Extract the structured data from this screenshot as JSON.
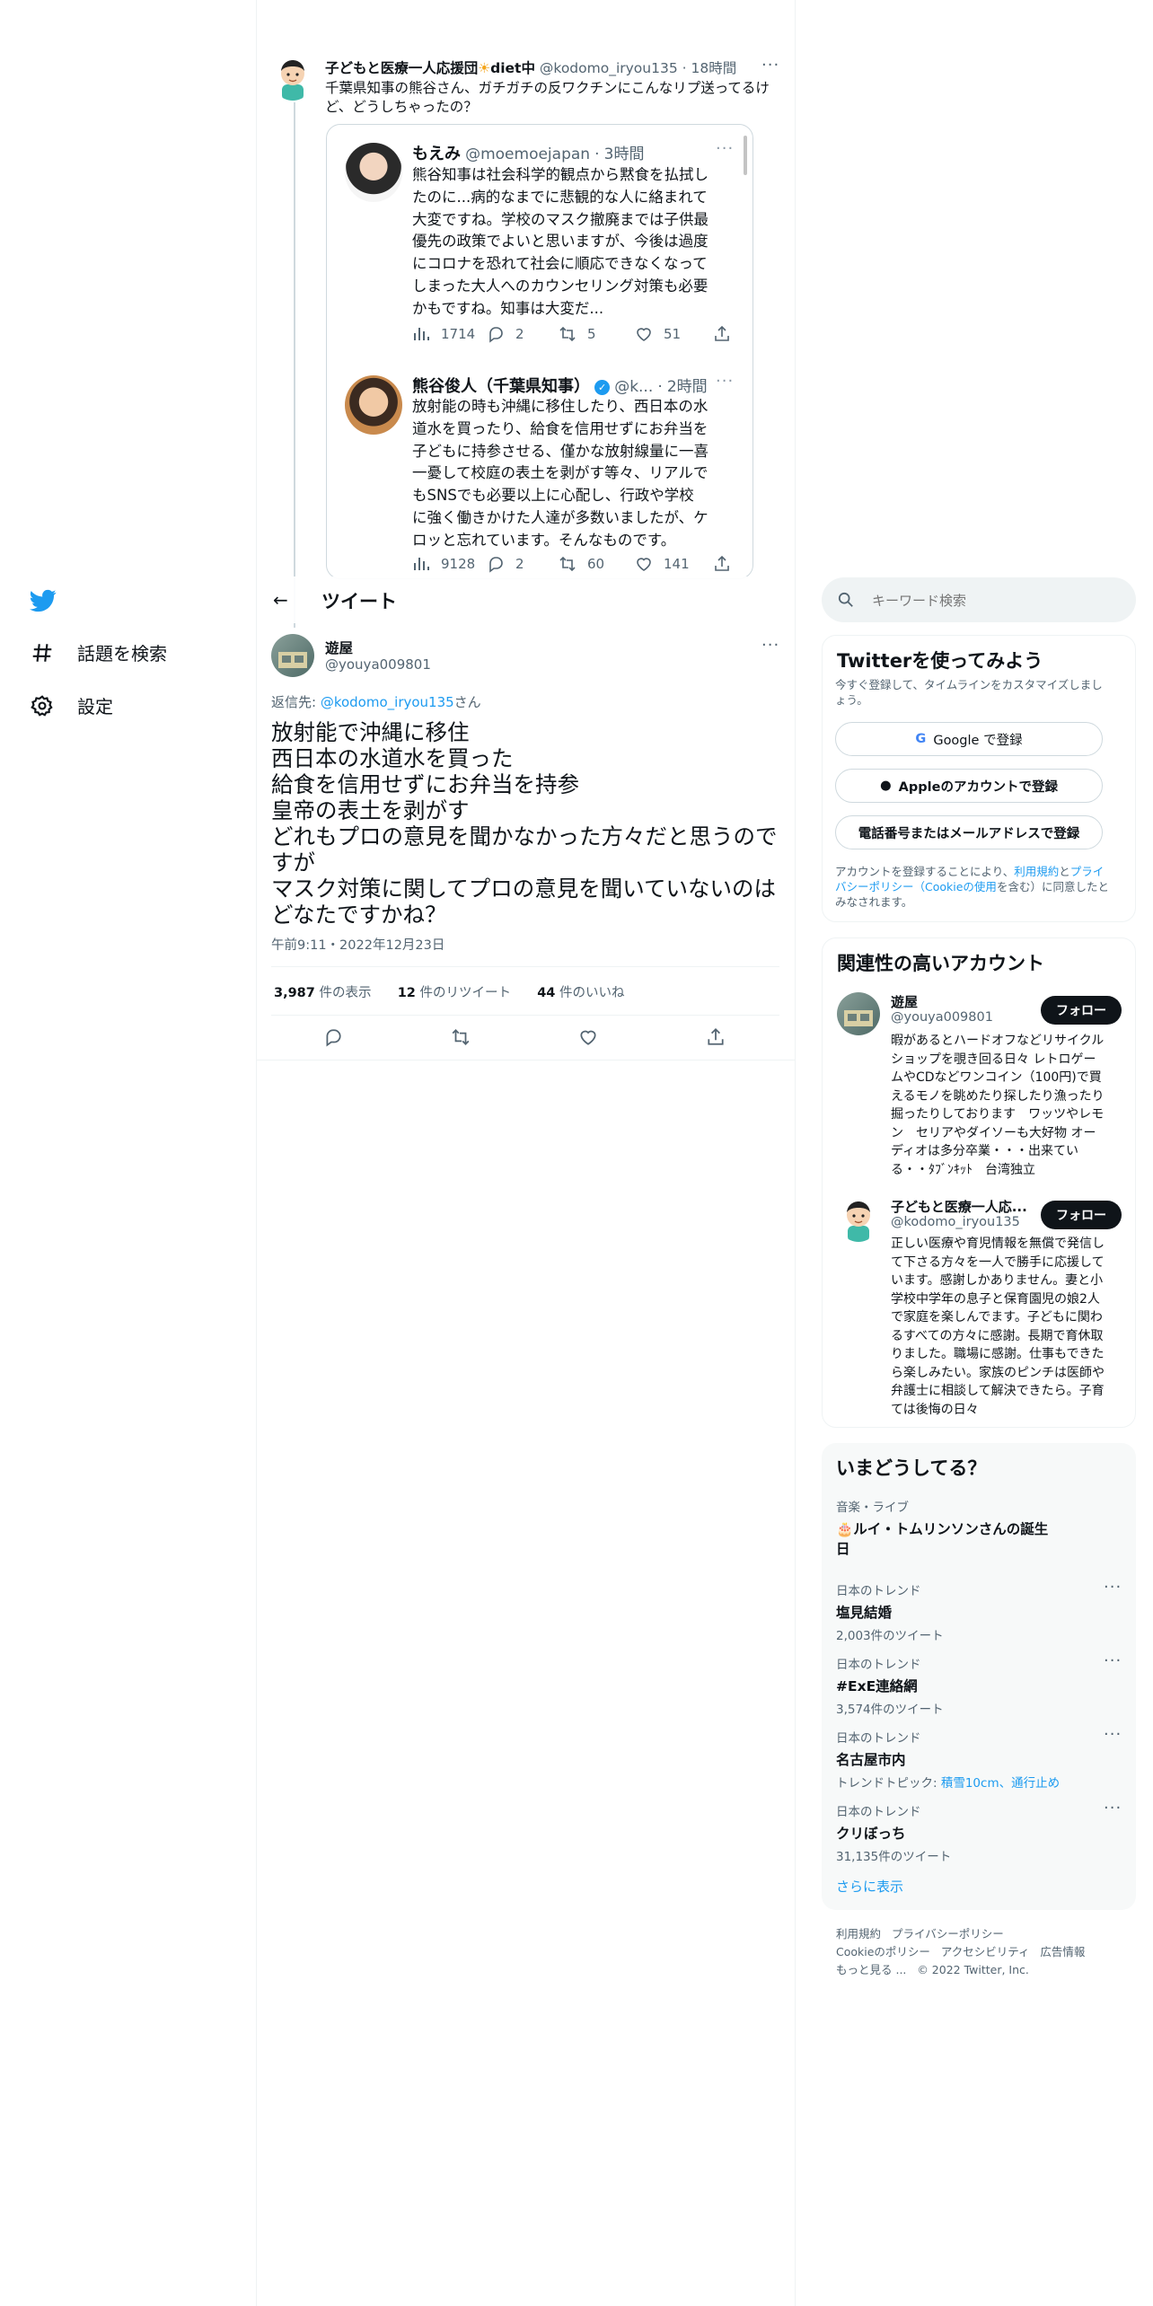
{
  "nav": {
    "items": [
      {
        "label": "話題を検索"
      },
      {
        "label": "設定"
      }
    ]
  },
  "header": {
    "title": "ツイート"
  },
  "parent_tweet": {
    "display_name": "子どもと医療一人応援団",
    "name_suffix": "diet中",
    "handle": "@kodomo_iryou135",
    "time": "18時間",
    "text_line1": "千葉県知事の熊谷さん、ガチガチの反ワクチンにこんなリプ送ってるけ",
    "text_line2": "ど、どうしちゃったの？"
  },
  "quote1": {
    "display_name": "もえみ",
    "handle": "@moemoejapan",
    "time": "3時間",
    "lines": [
      "熊谷知事は社会科学的観点から黙食を払拭し",
      "たのに...病的なまでに悲観的な人に絡まれて",
      "大変ですね。学校のマスク撤廃までは子供最",
      "優先の政策でよいと思いますが、今後は過度",
      "にコロナを恐れて社会に順応できなくなって",
      "しまった大人へのカウンセリング対策も必要",
      "かもですね。知事は大変だ..."
    ],
    "views": "1714",
    "replies": "2",
    "retweets": "5",
    "likes": "51"
  },
  "quote2": {
    "display_name": "熊谷俊人（千葉県知事）",
    "handle": "@k...",
    "time": "2時間",
    "lines": [
      "放射能の時も沖縄に移住したり、西日本の水",
      "道水を買ったり、給食を信用せずにお弁当を",
      "子どもに持参させる、僅かな放射線量に一喜",
      "一憂して校庭の表土を剥がす等々、リアルで",
      "もSNSでも必要以上に心配し、行政や学校",
      "に強く働きかけた人達が多数いましたが、ケ",
      "ロッと忘れています。そんなものです。"
    ],
    "views": "9128",
    "replies": "2",
    "retweets": "60",
    "likes": "141"
  },
  "main_tweet": {
    "display_name": "遊屋",
    "handle": "@youya009801",
    "reply_prefix": "返信先: ",
    "reply_to": "@kodomo_iryou135",
    "reply_suffix": "さん",
    "lines": [
      "放射能で沖縄に移住",
      "西日本の水道水を買った",
      "給食を信用せずにお弁当を持参",
      "皇帝の表土を剥がす",
      "どれもプロの意見を聞かなかった方々だと思うので",
      "すが",
      "マスク対策に関してプロの意見を聞いていないのは",
      "どなたですかね？"
    ],
    "timestamp": "午前9:11・2022年12月23日",
    "views_count": "3,987",
    "views_label": "件の表示",
    "retweets_count": "12",
    "retweets_label": "件のリツイート",
    "likes_count": "44",
    "likes_label": "件のいいね"
  },
  "search": {
    "placeholder": "キーワード検索"
  },
  "signup": {
    "title": "Twitterを使ってみよう",
    "subtitle": "今すぐ登録して、タイムラインをカスタマイズしまし",
    "subtitle2": "ょう。",
    "google": "Google で登録",
    "apple": "Appleのアカウントで登録",
    "phone": "電話番号またはメールアドレスで登録",
    "terms_a": "アカウントを登録することにより、",
    "terms_link1": "利用規約",
    "terms_b": "と",
    "terms_link2": "プライ",
    "terms_link3": "バシーポリシー（Cookieの使用",
    "terms_c": "を含む）に同意したと",
    "terms_d": "みなされます。"
  },
  "relevant": {
    "title": "関連性の高いアカウント",
    "accounts": [
      {
        "name": "遊屋",
        "handle": "@youya009801",
        "follow": "フォロー",
        "bio": [
          "暇があるとハードオフなどリサイクル",
          "ショップを覗き回る日々 レトロゲー",
          "ムやCDなどワンコイン（100円)で買",
          "えるモノを眺めたり探したり漁ったり",
          "掘ったりしております　ワッツやレモ",
          "ン　セリアやダイソーも大好物 オー",
          "ディオは多分卒業・・・出来てい",
          "る・・ﾀﾌﾞﾝｷｯﾄ　台湾独立"
        ]
      },
      {
        "name": "子どもと医療一人応...",
        "handle": "@kodomo_iryou135",
        "follow": "フォロー",
        "bio": [
          "正しい医療や育児情報を無償で発信し",
          "て下さる方々を一人で勝手に応援して",
          "います。感謝しかありません。妻と小",
          "学校中学年の息子と保育園児の娘2人",
          "で家庭を楽しんでます。子どもに関わ",
          "るすべての方々に感謝。長期で育休取",
          "りました。職場に感謝。仕事もできた",
          "ら楽しみたい。家族のピンチは医師や",
          "弁護士に相談して解決できたら。子育",
          "ては後悔の日々"
        ]
      }
    ]
  },
  "trends": {
    "title": "いまどうしてる？",
    "items": [
      {
        "category": "音楽・ライブ",
        "name1": "🎂ルイ・トムリンソンさんの誕生",
        "name2": "日"
      },
      {
        "category": "日本のトレンド",
        "name": "塩見結婚",
        "count": "2,003件のツイート"
      },
      {
        "category": "日本のトレンド",
        "name": "#ExE連絡網",
        "count": "3,574件のツイート"
      },
      {
        "category": "日本のトレンド",
        "name": "名古屋市内",
        "topic_prefix": "トレンドトピック: ",
        "topic": "積雪10cm、通行止め"
      },
      {
        "category": "日本のトレンド",
        "name": "クリぼっち",
        "count": "31,135件のツイート"
      }
    ],
    "show_more": "さらに表示"
  },
  "footer": {
    "links1": [
      "利用規約",
      "プライバシーポリシー"
    ],
    "links2": [
      "Cookieのポリシー",
      "アクセシビリティ",
      "広告情報"
    ],
    "more": "もっと見る ...",
    "copyright": "© 2022 Twitter, Inc."
  }
}
